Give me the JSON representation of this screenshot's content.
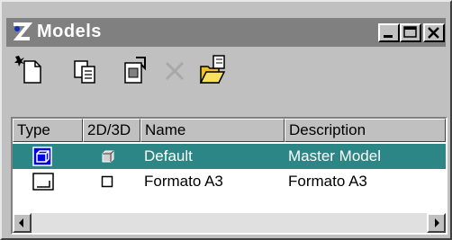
{
  "window": {
    "title": "Models",
    "title_icon": "microstation-logo-icon",
    "controls": [
      "minimize-icon",
      "maximize-icon",
      "close-icon"
    ]
  },
  "toolbar": {
    "tools": [
      {
        "name": "new-model-icon"
      },
      {
        "name": "copy-model-icon"
      },
      {
        "name": "model-properties-icon"
      },
      {
        "name": "delete-model-icon"
      },
      {
        "name": "import-model-icon"
      }
    ]
  },
  "list": {
    "columns": [
      "Type",
      "2D/3D",
      "Name",
      "Description"
    ],
    "rows": [
      {
        "type_icon": "design-model-icon",
        "dim_icon": "3d-cube-icon",
        "name": "Default",
        "description": "Master Model",
        "selected": true
      },
      {
        "type_icon": "sheet-model-icon",
        "dim_icon": "2d-square-icon",
        "name": "Formato A3",
        "description": "Formato A3",
        "selected": false
      }
    ]
  },
  "colors": {
    "selection": "#2d8686",
    "titlebar": "#808080",
    "face": "#c0c0c0"
  }
}
